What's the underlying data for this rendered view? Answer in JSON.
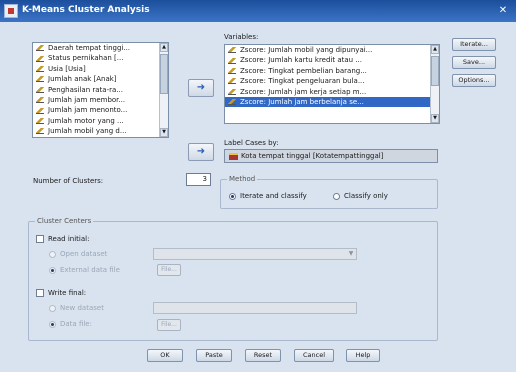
{
  "window": {
    "title": "K-Means Cluster Analysis",
    "close_glyph": "✕"
  },
  "source_list": {
    "items": [
      "Daerah tempat tinggi...",
      "Status pernikahan [...",
      "Usia [Usia]",
      "Jumlah anak [Anak]",
      "Penghasilan rata-ra...",
      "Jumlah jam membor...",
      "Jumlah jam menonto...",
      "Jumlah motor yang ...",
      "Jumlah mobil yang d..."
    ]
  },
  "variables": {
    "label": "Variables:",
    "items": [
      "Zscore:  Jumlah mobil yang dipunyai...",
      "Zscore:  Jumlah kartu kredit atau ...",
      "Zscore:  Tingkat pembelian barang...",
      "Zscore:  Tingkat pengeluaran bula...",
      "Zscore:  Jumlah jam kerja setiap m...",
      "Zscore:  Jumlah jam berbelanja se..."
    ]
  },
  "label_cases": {
    "label": "Label Cases by:",
    "value": "Kota tempat tinggal [Kotatempattinggal]"
  },
  "clusters": {
    "label": "Number of Clusters:",
    "value": "3"
  },
  "method": {
    "title": "Method",
    "iterate": "Iterate and classify",
    "classify": "Classify only"
  },
  "centers": {
    "title": "Cluster Centers",
    "read_initial": "Read initial:",
    "open_dataset": "Open dataset",
    "external_file": "External data file",
    "file_button": "File...",
    "write_final": "Write final:",
    "new_dataset": "New dataset",
    "data_file": "Data file:"
  },
  "side_buttons": {
    "iterate": "Iterate...",
    "save": "Save...",
    "options": "Options..."
  },
  "bottom_buttons": {
    "ok": "OK",
    "paste": "Paste",
    "reset": "Reset",
    "cancel": "Cancel",
    "help": "Help"
  },
  "icons": {
    "move_right": "➜",
    "move_into_label": "➜",
    "scroll_up": "▲",
    "scroll_down": "▼",
    "combo_drop": "▼"
  },
  "colors": {
    "title_bar": "#1b4f9c",
    "dialog_bg": "#d9e3f0",
    "selection": "#3168c6"
  }
}
